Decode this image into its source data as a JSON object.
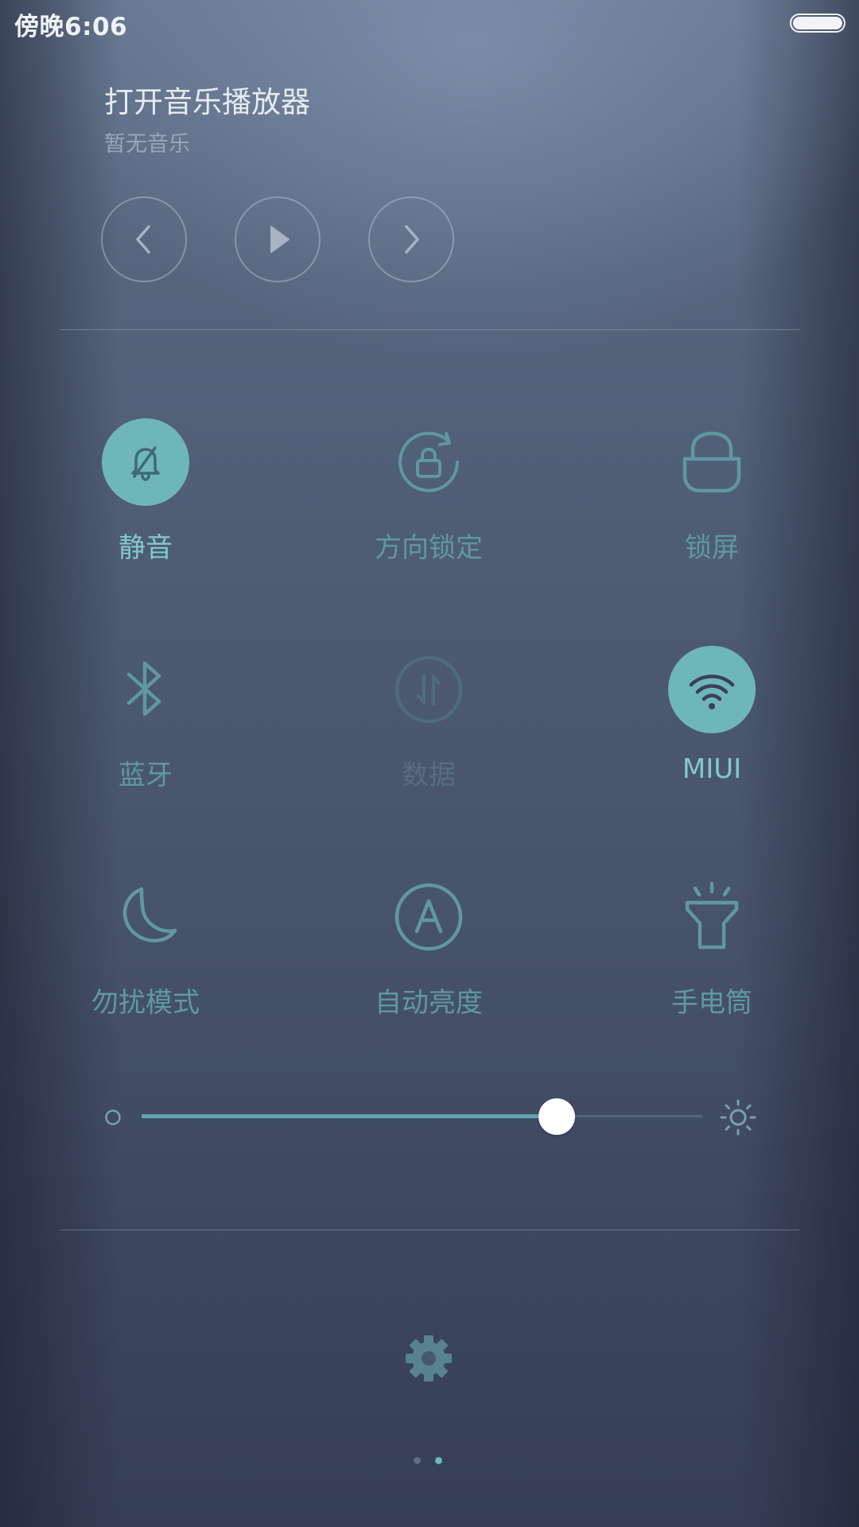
{
  "status_bar": {
    "time": "傍晚6:06"
  },
  "music": {
    "title": "打开音乐播放器",
    "subtitle": "暂无音乐"
  },
  "toggles": [
    {
      "label": "静音",
      "icon": "silent-bell-icon",
      "active": true
    },
    {
      "label": "方向锁定",
      "icon": "rotation-lock-icon",
      "active": false
    },
    {
      "label": "锁屏",
      "icon": "lock-icon",
      "active": false
    },
    {
      "label": "蓝牙",
      "icon": "bluetooth-icon",
      "active": false
    },
    {
      "label": "数据",
      "icon": "mobile-data-icon",
      "active": false,
      "disabled": true
    },
    {
      "label": "MIUI",
      "icon": "wifi-icon",
      "active": true
    },
    {
      "label": "勿扰模式",
      "icon": "moon-icon",
      "active": false
    },
    {
      "label": "自动亮度",
      "icon": "auto-brightness-icon",
      "active": false
    },
    {
      "label": "手电筒",
      "icon": "flashlight-icon",
      "active": false
    }
  ],
  "brightness": {
    "level": 0.74
  },
  "pager": {
    "count": 2,
    "current": 2
  },
  "colors": {
    "accent": "#6fb6bb",
    "icon_inactive": "#5f98a2"
  }
}
